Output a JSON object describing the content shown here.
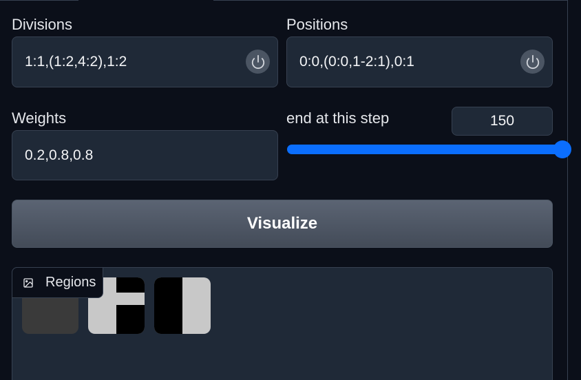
{
  "divisions": {
    "label": "Divisions",
    "value": "1:1,(1:2,4:2),1:2",
    "reset_icon": "power-icon"
  },
  "positions": {
    "label": "Positions",
    "value": "0:0,(0:0,1-2:1),0:1",
    "reset_icon": "power-icon"
  },
  "weights": {
    "label": "Weights",
    "value": "0.2,0.8,0.8"
  },
  "end_step": {
    "label": "end at this step",
    "value": "150",
    "slider_fraction": 1.0,
    "accent_color": "#0b6efd"
  },
  "visualize": {
    "label": "Visualize"
  },
  "regions": {
    "label": "Regions",
    "icon": "image-icon",
    "thumbnails": [
      {
        "name": "region-full-gray"
      },
      {
        "name": "region-split-top-bottom"
      },
      {
        "name": "region-split-left-right"
      }
    ]
  }
}
